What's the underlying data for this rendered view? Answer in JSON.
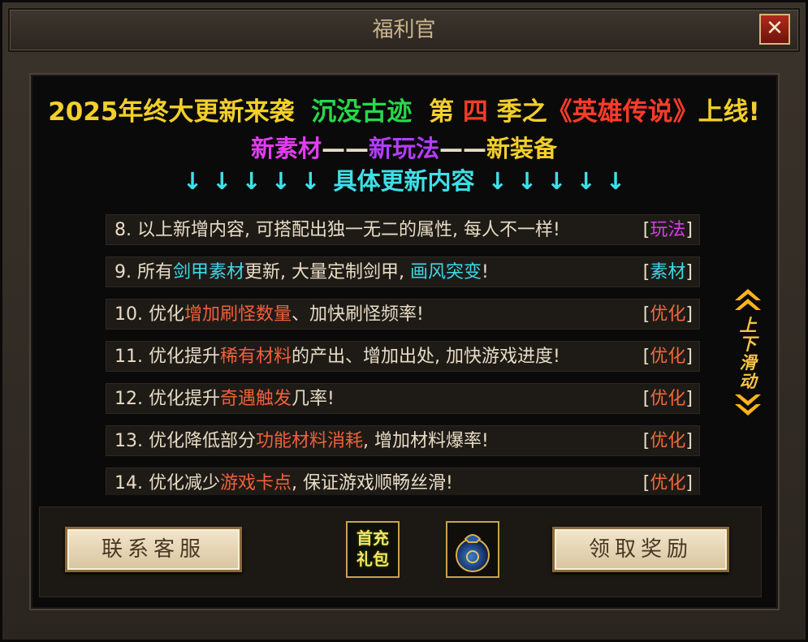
{
  "window": {
    "title": "福利官",
    "close_glyph": "✕"
  },
  "headline": {
    "part1": "2025年终大更新来袭",
    "part2": "沉没古迹",
    "part3": "第",
    "part4": "四",
    "part5": "季之",
    "part6": "《英雄传说》",
    "part7": "上线!"
  },
  "subline": {
    "a": "新素材",
    "dash1": "——",
    "b": "新玩法",
    "dash2": "——",
    "c": "新装备"
  },
  "arrows": {
    "glyph": "↓",
    "label": "具体更新内容"
  },
  "rows": [
    {
      "seg1": "8. 以上新增内容, 可搭配出独一无二的属性, 每人不一样!",
      "tag_open": "[",
      "tag": "玩法",
      "tag_close": "]"
    },
    {
      "seg1": "9. 所有",
      "hl1": "剑甲素材",
      "seg2": "更新, 大量定制剑甲, ",
      "hl2": "画风突变",
      "seg3": "!",
      "tag_open": "[",
      "tag": "素材",
      "tag_close": "]"
    },
    {
      "seg1": "10. 优化",
      "hl1": "增加刷怪数量",
      "seg2": "、加快刷怪频率!",
      "tag_open": "[",
      "tag": "优化",
      "tag_close": "]"
    },
    {
      "seg1": "11. 优化提升",
      "hl1": "稀有材料",
      "seg2": "的产出、增加出处, 加快游戏进度!",
      "tag_open": "[",
      "tag": "优化",
      "tag_close": "]"
    },
    {
      "seg1": "12. 优化提升",
      "hl1": "奇遇触发",
      "seg2": "几率!",
      "tag_open": "[",
      "tag": "优化",
      "tag_close": "]"
    },
    {
      "seg1": "13. 优化降低部分",
      "hl1": "功能材料消耗",
      "seg2": ", 增加材料爆率!",
      "tag_open": "[",
      "tag": "优化",
      "tag_close": "]"
    },
    {
      "seg1": "14. 优化减少",
      "hl1": "游戏卡点",
      "seg2": ", 保证游戏顺畅丝滑!",
      "tag_open": "[",
      "tag": "优化",
      "tag_close": "]"
    }
  ],
  "scroll_hint": {
    "line1": "上",
    "line2": "下",
    "line3": "滑",
    "line4": "动"
  },
  "buttons": {
    "contact": "联系客服",
    "first_charge_top": "首充",
    "first_charge_bottom": "礼包",
    "claim": "领取奖励"
  },
  "colors": {
    "gold": "#f2cf2b",
    "green": "#27d84a",
    "red": "#ff3b2a",
    "magenta": "#e23df0",
    "cyan": "#3ee0e8",
    "orange_red": "#f0603a",
    "tag_magenta": "#d63ee8",
    "tag_cyan": "#3ed8e8",
    "tag_orange": "#f06a3a"
  }
}
